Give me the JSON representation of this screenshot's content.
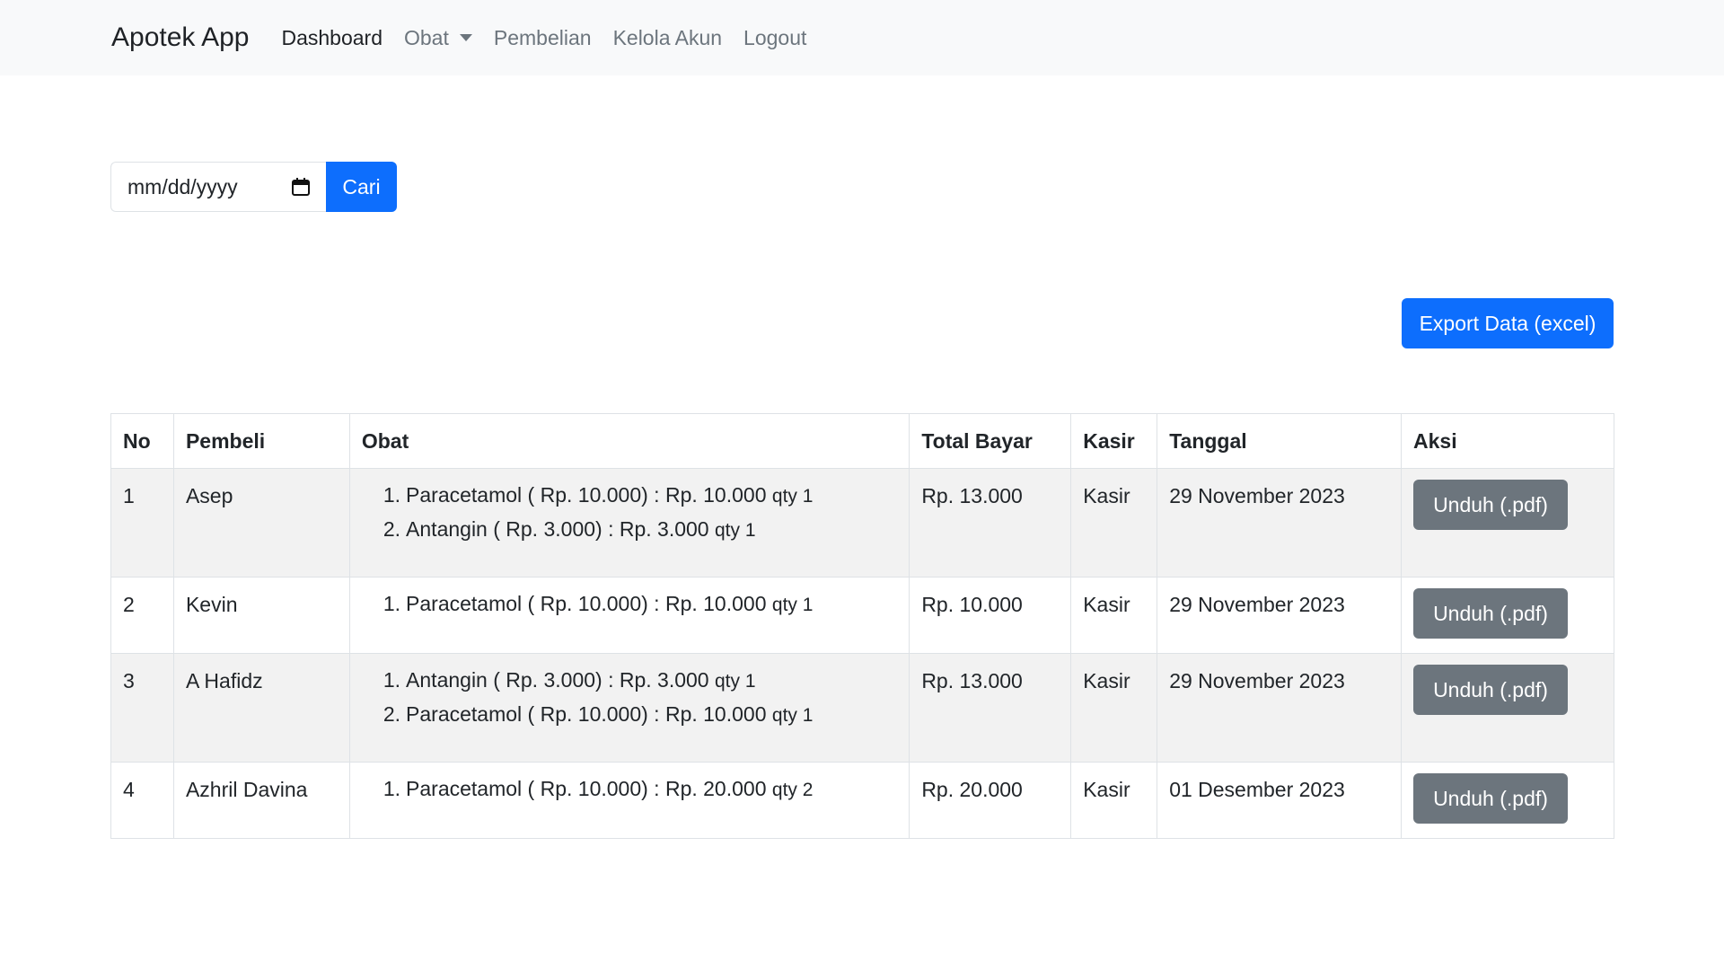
{
  "navbar": {
    "brand": "Apotek App",
    "links": [
      {
        "label": "Dashboard"
      },
      {
        "label": "Obat"
      },
      {
        "label": "Pembelian"
      },
      {
        "label": "Kelola Akun"
      },
      {
        "label": "Logout"
      }
    ]
  },
  "search": {
    "date_placeholder": "mm/dd/yyyy",
    "button_label": "Cari"
  },
  "export_label": "Export Data (excel)",
  "table": {
    "headers": [
      "No",
      "Pembeli",
      "Obat",
      "Total Bayar",
      "Kasir",
      "Tanggal",
      "Aksi"
    ],
    "rows": [
      {
        "no": "1",
        "pembeli": "Asep",
        "items": [
          {
            "num": "1.",
            "text": "Paracetamol ( Rp. 10.000) : Rp. 10.000",
            "qty": "qty 1"
          },
          {
            "num": "2.",
            "text": "Antangin ( Rp. 3.000) : Rp. 3.000",
            "qty": "qty 1"
          }
        ],
        "total": "Rp. 13.000",
        "kasir": "Kasir",
        "tanggal": "29 November 2023",
        "aksi": "Unduh (.pdf)"
      },
      {
        "no": "2",
        "pembeli": "Kevin",
        "items": [
          {
            "num": "1.",
            "text": "Paracetamol ( Rp. 10.000) : Rp. 10.000",
            "qty": "qty 1"
          }
        ],
        "total": "Rp. 10.000",
        "kasir": "Kasir",
        "tanggal": "29 November 2023",
        "aksi": "Unduh (.pdf)"
      },
      {
        "no": "3",
        "pembeli": "A Hafidz",
        "items": [
          {
            "num": "1.",
            "text": "Antangin ( Rp. 3.000) : Rp. 3.000",
            "qty": "qty 1"
          },
          {
            "num": "2.",
            "text": "Paracetamol ( Rp. 10.000) : Rp. 10.000",
            "qty": "qty 1"
          }
        ],
        "total": "Rp. 13.000",
        "kasir": "Kasir",
        "tanggal": "29 November 2023",
        "aksi": "Unduh (.pdf)"
      },
      {
        "no": "4",
        "pembeli": "Azhril Davina",
        "items": [
          {
            "num": "1.",
            "text": "Paracetamol ( Rp. 10.000) : Rp. 20.000",
            "qty": "qty 2"
          }
        ],
        "total": "Rp. 20.000",
        "kasir": "Kasir",
        "tanggal": "01 Desember 2023",
        "aksi": "Unduh (.pdf)"
      }
    ]
  }
}
